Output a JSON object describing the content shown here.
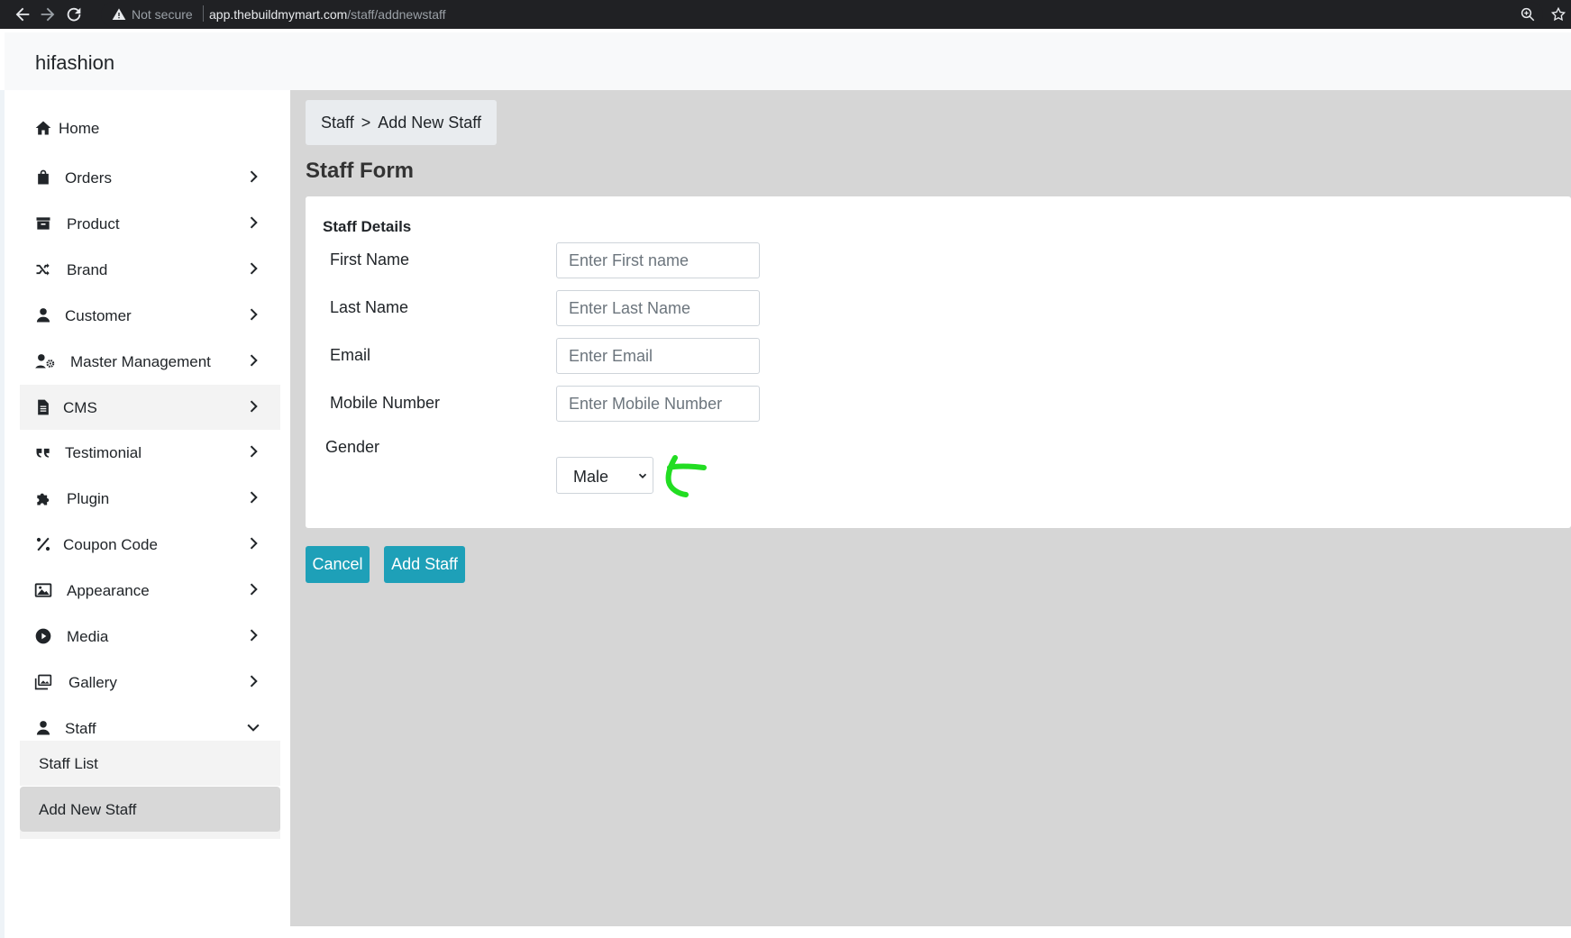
{
  "browser": {
    "security_label": "Not secure",
    "url_host": "app.thebuildmymart.com",
    "url_path": "/staff/addnewstaff"
  },
  "app": {
    "brand": "hifashion"
  },
  "sidebar": {
    "items": [
      {
        "label": "Home",
        "icon": "home-icon",
        "has_chevron": false
      },
      {
        "label": "Orders",
        "icon": "shopping-bag-icon",
        "has_chevron": true
      },
      {
        "label": "Product",
        "icon": "archive-icon",
        "has_chevron": true
      },
      {
        "label": "Brand",
        "icon": "shuffle-icon",
        "has_chevron": true
      },
      {
        "label": "Customer",
        "icon": "user-icon",
        "has_chevron": true
      },
      {
        "label": "Master Management",
        "icon": "user-gear-icon",
        "has_chevron": true
      },
      {
        "label": "CMS",
        "icon": "file-icon",
        "has_chevron": true
      },
      {
        "label": "Testimonial",
        "icon": "quote-icon",
        "has_chevron": true
      },
      {
        "label": "Plugin",
        "icon": "puzzle-icon",
        "has_chevron": true
      },
      {
        "label": "Coupon Code",
        "icon": "percent-icon",
        "has_chevron": true
      },
      {
        "label": "Appearance",
        "icon": "image-icon",
        "has_chevron": true
      },
      {
        "label": "Media",
        "icon": "play-circle-icon",
        "has_chevron": true
      },
      {
        "label": "Gallery",
        "icon": "images-icon",
        "has_chevron": true
      },
      {
        "label": "Staff",
        "icon": "user-icon",
        "has_chevron": true,
        "expanded": true
      }
    ],
    "sub_items": [
      {
        "label": "Staff List"
      },
      {
        "label": "Add New Staff",
        "active": true
      }
    ]
  },
  "breadcrumb": {
    "parent": "Staff",
    "separator": ">",
    "current": "Add New Staff"
  },
  "page": {
    "title": "Staff Form"
  },
  "form": {
    "section_title": "Staff Details",
    "fields": [
      {
        "label": "First Name",
        "placeholder": "Enter First name",
        "value": ""
      },
      {
        "label": "Last Name",
        "placeholder": "Enter Last Name",
        "value": ""
      },
      {
        "label": "Email",
        "placeholder": "Enter Email",
        "value": ""
      },
      {
        "label": "Mobile Number",
        "placeholder": "Enter Mobile Number",
        "value": ""
      }
    ],
    "gender": {
      "label": "Gender",
      "selected": "Male"
    }
  },
  "actions": {
    "cancel": "Cancel",
    "submit": "Add Staff"
  },
  "colors": {
    "primary_button": "#1ea0b8",
    "main_background": "#d6d6d6",
    "annotation_arrow": "#22dd22"
  }
}
